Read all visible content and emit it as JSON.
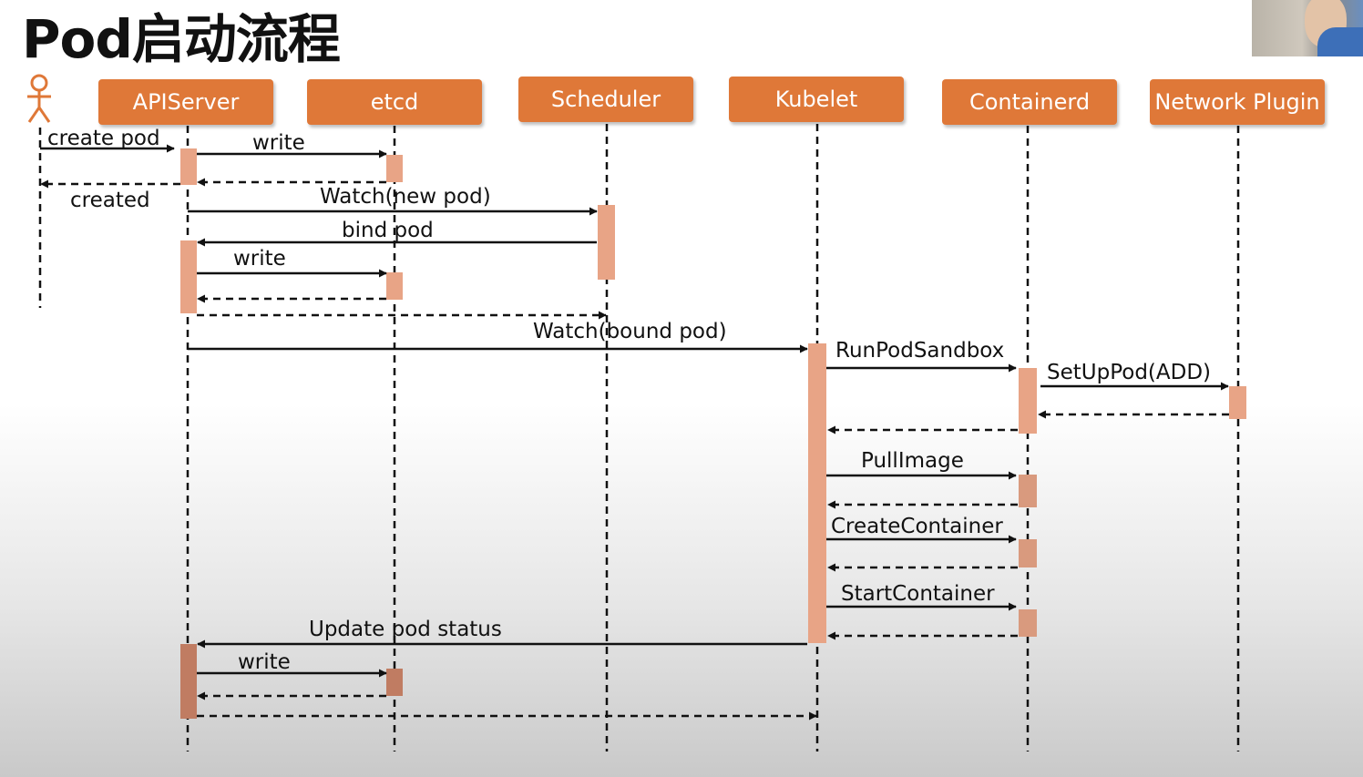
{
  "title": "Pod启动流程",
  "colors": {
    "participant": "#df7838",
    "activation": "#e8a486",
    "activation_dark": "#c07c62",
    "line": "#111111"
  },
  "participants": {
    "apiserver": "APIServer",
    "etcd": "etcd",
    "scheduler": "Scheduler",
    "kubelet": "Kubelet",
    "containerd": "Containerd",
    "network": "Network Plugin"
  },
  "messages": {
    "create_pod": "create pod",
    "write1": "write",
    "created": "created",
    "watch_new_pod": "Watch(new pod)",
    "bind_pod": "bind pod",
    "write2": "write",
    "watch_bound_pod": "Watch(bound pod)",
    "run_pod_sandbox": "RunPodSandbox",
    "set_up_pod": "SetUpPod(ADD)",
    "pull_image": "PullImage",
    "create_container": "CreateContainer",
    "start_container": "StartContainer",
    "update_pod_status": "Update pod status",
    "write3": "write"
  }
}
